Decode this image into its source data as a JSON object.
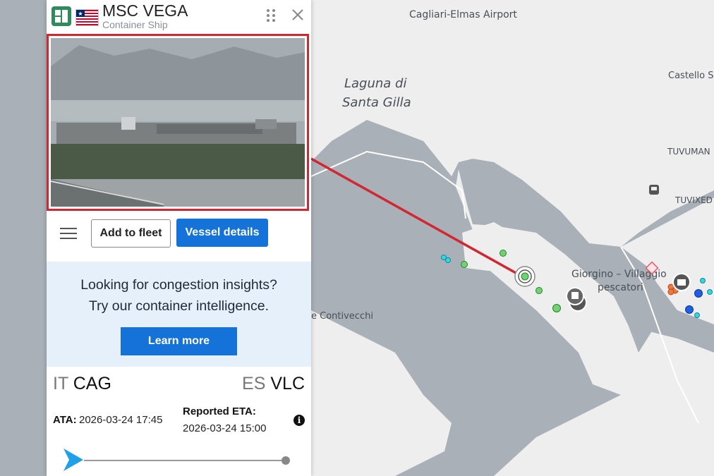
{
  "map": {
    "labels": {
      "airport": "Cagliari-Elmas Airport",
      "castello": "Castello S",
      "laguna_1": "Laguna di",
      "laguna_2": "Santa Gilla",
      "tuvuman": "TUVUMAN",
      "tuvixed": "TUVIXED",
      "giorgino_1": "Giorgino – Villaggio",
      "giorgino_2": "pescatori",
      "contivecchi": "e Contivecchi"
    },
    "colors": {
      "water": "#aab0b8",
      "land": "#eeeeee",
      "highlight": "#d22630",
      "vessel_green": "#6fd46f",
      "vessel_cyan": "#35d6e6",
      "vessel_blue": "#1f5fe0",
      "vessel_orange": "#f07840"
    }
  },
  "panel": {
    "vessel_name": "MSC VEGA",
    "vessel_type": "Container Ship",
    "flag_icon": "liberia-flag-icon",
    "actions": {
      "add_fleet": "Add to fleet",
      "vessel_details": "Vessel details"
    },
    "promo": {
      "line1": "Looking for congestion insights?",
      "line2": "Try our container intelligence.",
      "button": "Learn more"
    },
    "voyage": {
      "from_country": "IT",
      "from_port": "CAG",
      "to_country": "ES",
      "to_port": "VLC",
      "ata_label": "ATA:",
      "ata_value": "2026-03-24 17:45",
      "eta_label": "Reported ETA:",
      "eta_value": "2026-03-24 15:00",
      "info_glyph": "i",
      "progress": 0
    },
    "colors": {
      "accent": "#1472d8",
      "logo": "#2e8b5e",
      "promo_bg": "#e6f0fb"
    }
  }
}
